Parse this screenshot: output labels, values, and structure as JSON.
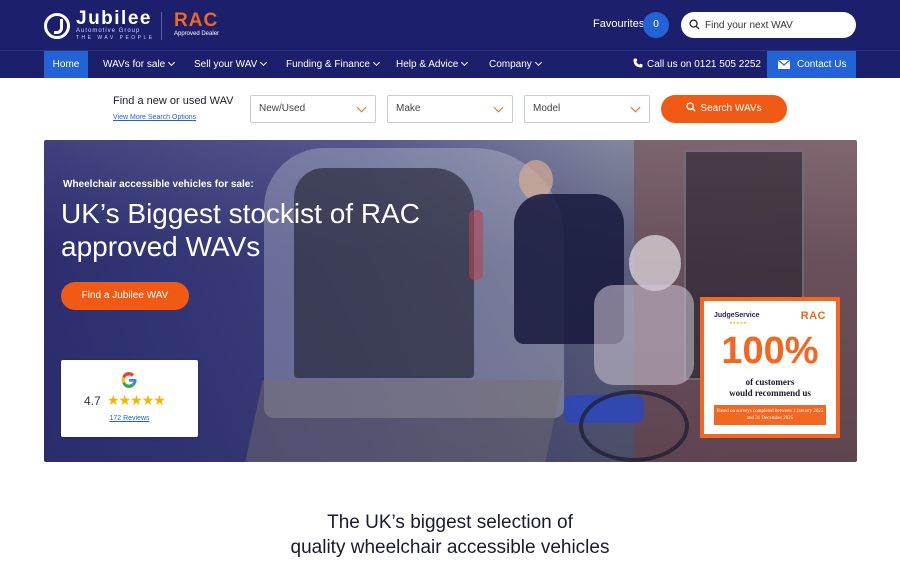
{
  "brand": {
    "name": "Jubilee",
    "sub": "Automotive Group",
    "tagline": "THE WAV PEOPLE",
    "partner": "RAC",
    "partner_sub": "Approved Dealer"
  },
  "header": {
    "favourites_label": "Favourites",
    "favourites_count": "0",
    "search_placeholder": "Find your next WAV"
  },
  "nav": {
    "items": [
      {
        "label": "Home"
      },
      {
        "label": "WAVs for sale"
      },
      {
        "label": "Sell your WAV"
      },
      {
        "label": "Funding & Finance"
      },
      {
        "label": "Help & Advice"
      },
      {
        "label": "Company"
      }
    ],
    "phone": "Call us on 0121 505 2252",
    "contact": "Contact Us"
  },
  "finder": {
    "title": "Find a new or used WAV",
    "more_link": "View More Search Options",
    "selects": [
      {
        "value": "New/Used"
      },
      {
        "value": "Make"
      },
      {
        "value": "Model"
      }
    ],
    "button": "Search WAVs"
  },
  "hero": {
    "kicker": "Wheelchair accessible vehicles for sale:",
    "title": "UK’s Biggest stockist of RAC approved WAVs",
    "button": "Find a Jubilee WAV"
  },
  "reviews": {
    "rating": "4.7",
    "stars": "★★★★★",
    "count_label": "172 Reviews"
  },
  "badge": {
    "judge": "JudgeService",
    "judge_stars": "★★★★★",
    "rac": "RAC",
    "percent": "100%",
    "line1": "of customers",
    "line2": "would recommend us",
    "footnote": "Based on surveys completed between 1 January 2025 and 31 December 2025"
  },
  "section": {
    "title_line1": "The UK’s biggest selection of",
    "title_line2": "quality wheelchair accessible vehicles"
  },
  "colors": {
    "navy": "#1c1f6b",
    "blue": "#2463d6",
    "orange": "#f05a14"
  }
}
